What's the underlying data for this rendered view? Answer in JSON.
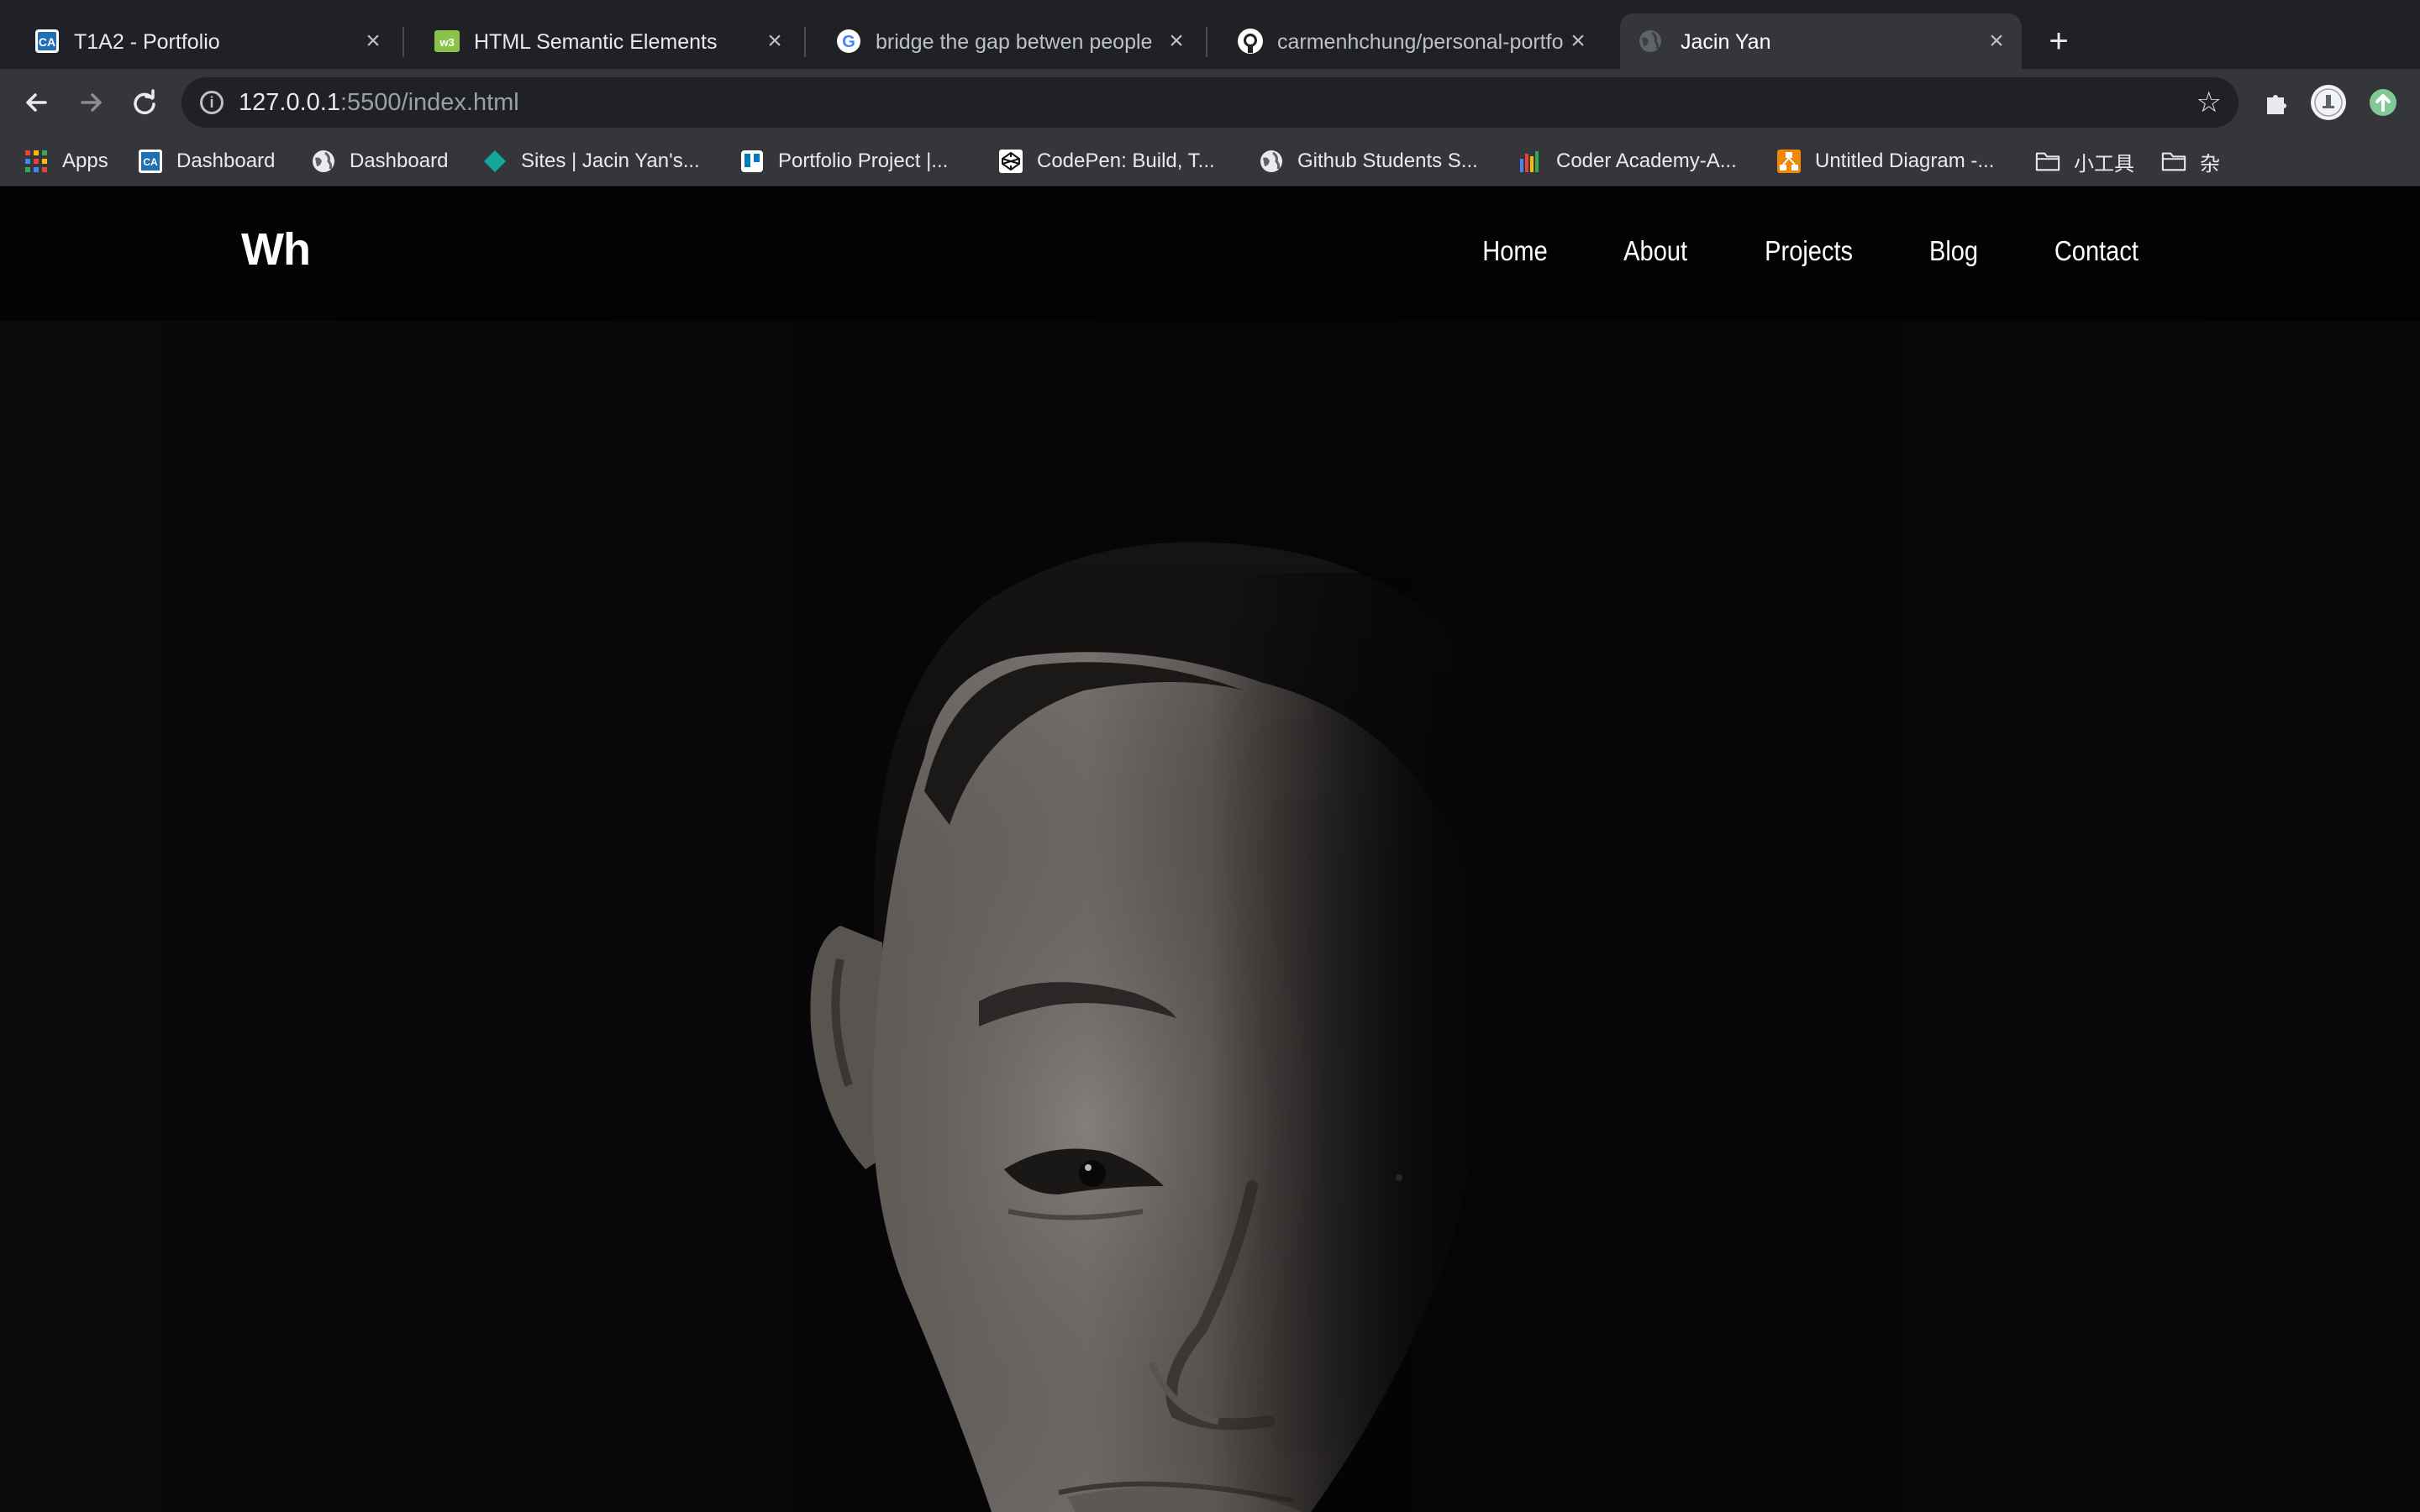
{
  "browser": {
    "tabs": [
      {
        "title": "T1A2 - Portfolio",
        "icon": "coder-academy-icon",
        "active": false
      },
      {
        "title": "HTML Semantic Elements",
        "icon": "w3schools-icon",
        "active": false
      },
      {
        "title": "bridge the gap betwen people",
        "icon": "google-icon",
        "active": false
      },
      {
        "title": "carmenhchung/personal-portfolio",
        "icon": "github-icon",
        "active": false
      },
      {
        "title": "Jacin Yan",
        "icon": "globe-icon",
        "active": true
      }
    ],
    "address": {
      "host": "127.0.0.1",
      "path": ":5500/index.html"
    },
    "bookmarks": [
      {
        "label": "Apps",
        "icon": "apps-grid-icon"
      },
      {
        "label": "Dashboard",
        "icon": "coder-academy-icon"
      },
      {
        "label": "Dashboard",
        "icon": "globe-icon"
      },
      {
        "label": "Sites | Jacin Yan's...",
        "icon": "google-sites-icon"
      },
      {
        "label": "Portfolio Project |...",
        "icon": "trello-icon"
      },
      {
        "label": "CodePen: Build, T...",
        "icon": "codepen-icon"
      },
      {
        "label": "Github Students S...",
        "icon": "globe-icon"
      },
      {
        "label": "Coder Academy-A...",
        "icon": "chart-icon"
      },
      {
        "label": "Untitled Diagram -...",
        "icon": "drawio-icon"
      },
      {
        "label": "小工具",
        "icon": "folder-icon"
      },
      {
        "label": "杂",
        "icon": "folder-icon"
      }
    ]
  },
  "site": {
    "logo": "Wh",
    "nav": [
      "Home",
      "About",
      "Projects",
      "Blog",
      "Contact"
    ],
    "hero": {
      "image": "portrait-half-lit-face"
    }
  },
  "colors": {
    "tabstrip": "#202124",
    "toolbar": "#35363a",
    "page_bg": "#050507",
    "text": "#ffffff"
  }
}
